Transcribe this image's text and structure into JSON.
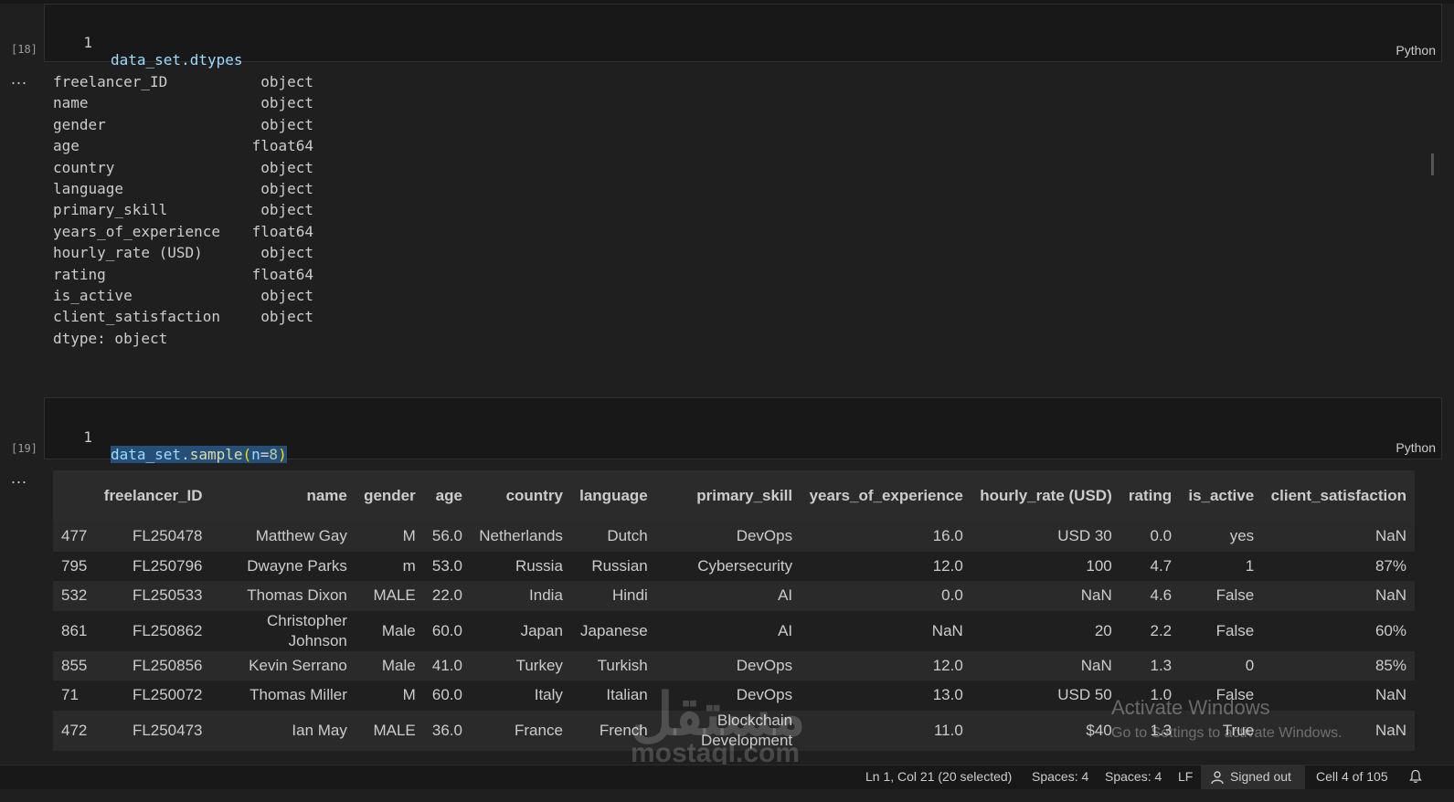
{
  "cells": [
    {
      "exec_count": "[18]",
      "line_no": "1",
      "code": "data_set.dtypes",
      "language": "Python",
      "output_prompt": "...",
      "dtypes": [
        {
          "col": "freelancer_ID",
          "type": "object"
        },
        {
          "col": "name",
          "type": "object"
        },
        {
          "col": "gender",
          "type": "object"
        },
        {
          "col": "age",
          "type": "float64"
        },
        {
          "col": "country",
          "type": "object"
        },
        {
          "col": "language",
          "type": "object"
        },
        {
          "col": "primary_skill",
          "type": "object"
        },
        {
          "col": "years_of_experience",
          "type": "float64"
        },
        {
          "col": "hourly_rate (USD)",
          "type": "object"
        },
        {
          "col": "rating",
          "type": "float64"
        },
        {
          "col": "is_active",
          "type": "object"
        },
        {
          "col": "client_satisfaction",
          "type": "object"
        }
      ],
      "dtype_footer": "dtype: object"
    },
    {
      "exec_count": "[19]",
      "line_no": "1",
      "code_obj": "data_set",
      "code_dot": ".",
      "code_fn": "sample",
      "code_lparen": "(",
      "code_arg": "n",
      "code_eq": "=",
      "code_num": "8",
      "code_rparen": ")",
      "language": "Python",
      "output_prompt": "..."
    }
  ],
  "table": {
    "headers": [
      "",
      "freelancer_ID",
      "name",
      "gender",
      "age",
      "country",
      "language",
      "primary_skill",
      "years_of_experience",
      "hourly_rate (USD)",
      "rating",
      "is_active",
      "client_satisfaction"
    ],
    "rows": [
      [
        "477",
        "FL250478",
        "Matthew Gay",
        "M",
        "56.0",
        "Netherlands",
        "Dutch",
        "DevOps",
        "16.0",
        "USD 30",
        "0.0",
        "yes",
        "NaN"
      ],
      [
        "795",
        "FL250796",
        "Dwayne Parks",
        "m",
        "53.0",
        "Russia",
        "Russian",
        "Cybersecurity",
        "12.0",
        "100",
        "4.7",
        "1",
        "87%"
      ],
      [
        "532",
        "FL250533",
        "Thomas Dixon",
        "MALE",
        "22.0",
        "India",
        "Hindi",
        "AI",
        "0.0",
        "NaN",
        "4.6",
        "False",
        "NaN"
      ],
      [
        "861",
        "FL250862",
        "Christopher Johnson",
        "Male",
        "60.0",
        "Japan",
        "Japanese",
        "AI",
        "NaN",
        "20",
        "2.2",
        "False",
        "60%"
      ],
      [
        "855",
        "FL250856",
        "Kevin Serrano",
        "Male",
        "41.0",
        "Turkey",
        "Turkish",
        "DevOps",
        "12.0",
        "NaN",
        "1.3",
        "0",
        "85%"
      ],
      [
        "71",
        "FL250072",
        "Thomas Miller",
        "M",
        "60.0",
        "Italy",
        "Italian",
        "DevOps",
        "13.0",
        "USD 50",
        "1.0",
        "False",
        "NaN"
      ],
      [
        "472",
        "FL250473",
        "Ian May",
        "MALE",
        "36.0",
        "France",
        "French",
        "Blockchain Development",
        "11.0",
        "$40",
        "1.3",
        "True",
        "NaN"
      ]
    ]
  },
  "watermark": {
    "arabic": "مستقل",
    "latin": "mostaql.com"
  },
  "activation": {
    "title": "Activate Windows",
    "subtitle": "Go to Settings to activate Windows."
  },
  "statusbar": {
    "cursor": "Ln 1, Col 21 (20 selected)",
    "spaces1": "Spaces: 4",
    "spaces2": "Spaces: 4",
    "eol": "LF",
    "account": "Signed out",
    "cell": "Cell 4 of 105",
    "bell_icon": "bell-icon",
    "account_icon": "account-icon"
  }
}
